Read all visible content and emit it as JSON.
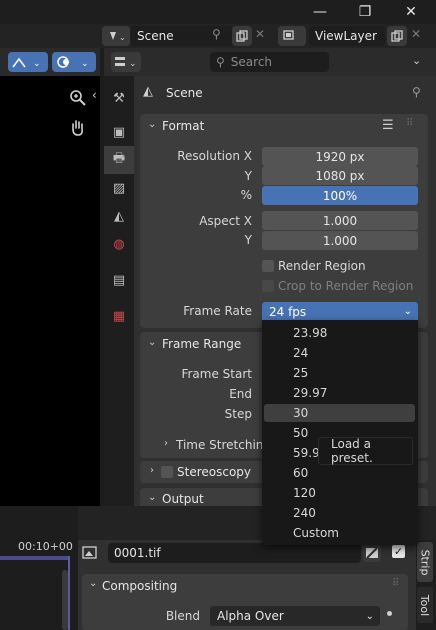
{
  "window": {
    "minimize": "—",
    "maximize": "❐",
    "close": "✕"
  },
  "header": {
    "scene_name": "Scene",
    "view_layer": "ViewLayer",
    "search_placeholder": "Search"
  },
  "properties": {
    "breadcrumb": "Scene",
    "format_panel": {
      "title": "Format",
      "resolution_x_label": "Resolution X",
      "resolution_x": "1920 px",
      "resolution_y_label": "Y",
      "resolution_y": "1080 px",
      "percent_label": "%",
      "percent": "100%",
      "percent_fill": 1.0,
      "aspect_x_label": "Aspect X",
      "aspect_x": "1.000",
      "aspect_y_label": "Y",
      "aspect_y": "1.000",
      "render_region": "Render Region",
      "crop_region": "Crop to Render Region",
      "frame_rate_label": "Frame Rate",
      "frame_rate": "24 fps"
    },
    "frame_range_panel": {
      "title": "Frame Range",
      "frame_start": "Frame Start",
      "end": "End",
      "step": "Step"
    },
    "time_stretching": "Time Stretching",
    "stereoscopy": "Stereoscopy",
    "output": "Output"
  },
  "frame_rate_menu": {
    "items": [
      "23.98",
      "24",
      "25",
      "29.97",
      "30",
      "50",
      "59.9",
      "60",
      "120",
      "240",
      "Custom"
    ],
    "highlighted": "30",
    "tooltip": "Load a preset."
  },
  "timeline": {
    "time": "00:10+00"
  },
  "strip_sidebar": {
    "filename": "0001.tif",
    "compositing_title": "Compositing",
    "blend_label": "Blend",
    "blend_value": "Alpha Over",
    "tab_strip": "Strip",
    "tab_tool": "Tool"
  },
  "colors": {
    "accent": "#4772b3",
    "panel": "#3d3d3d",
    "field": "#545454"
  }
}
